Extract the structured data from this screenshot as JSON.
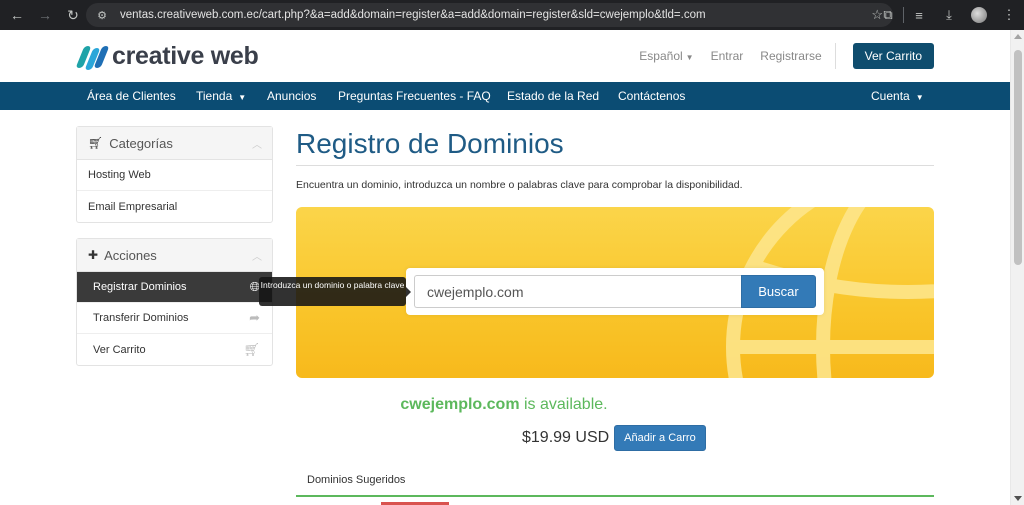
{
  "browser": {
    "url": "ventas.creativeweb.com.ec/cart.php?&a=add&domain=register&a=add&domain=register&sld=cwejemplo&tld=.com"
  },
  "header": {
    "brand": "creative web",
    "language": "Español",
    "login": "Entrar",
    "register": "Registrarse",
    "cart": "Ver Carrito"
  },
  "nav": {
    "items": [
      "Área de Clientes",
      "Tienda",
      "Anuncios",
      "Preguntas Frecuentes - FAQ",
      "Estado de la Red",
      "Contáctenos"
    ],
    "account": "Cuenta"
  },
  "sidebar": {
    "categories": {
      "title": "Categorías",
      "items": [
        "Hosting Web",
        "Email Empresarial"
      ]
    },
    "actions": {
      "title": "Acciones",
      "items": [
        "Registrar Dominios",
        "Transferir Dominios",
        "Ver Carrito"
      ]
    }
  },
  "main": {
    "title": "Registro de Dominios",
    "intro": "Encuentra un dominio, introduzca un nombre o palabras clave para comprobar la disponibilidad.",
    "search_value": "cwejemplo.com",
    "search_button": "Buscar",
    "tooltip": "Introduzca un dominio o palabra clave",
    "result_domain": "cwejemplo.com",
    "result_status": "is available.",
    "price": "$19.99 USD",
    "add_to_cart": "Añadir a Carro",
    "suggested_tab": "Dominios Sugeridos"
  },
  "colors": {
    "nav_bg": "#0b4c73",
    "title": "#1f5b85",
    "primary_button": "#337ab7",
    "available_green": "#5cb85c",
    "banner_yellow": "#f9c52a",
    "active_sidebar": "#3a3a3a"
  }
}
